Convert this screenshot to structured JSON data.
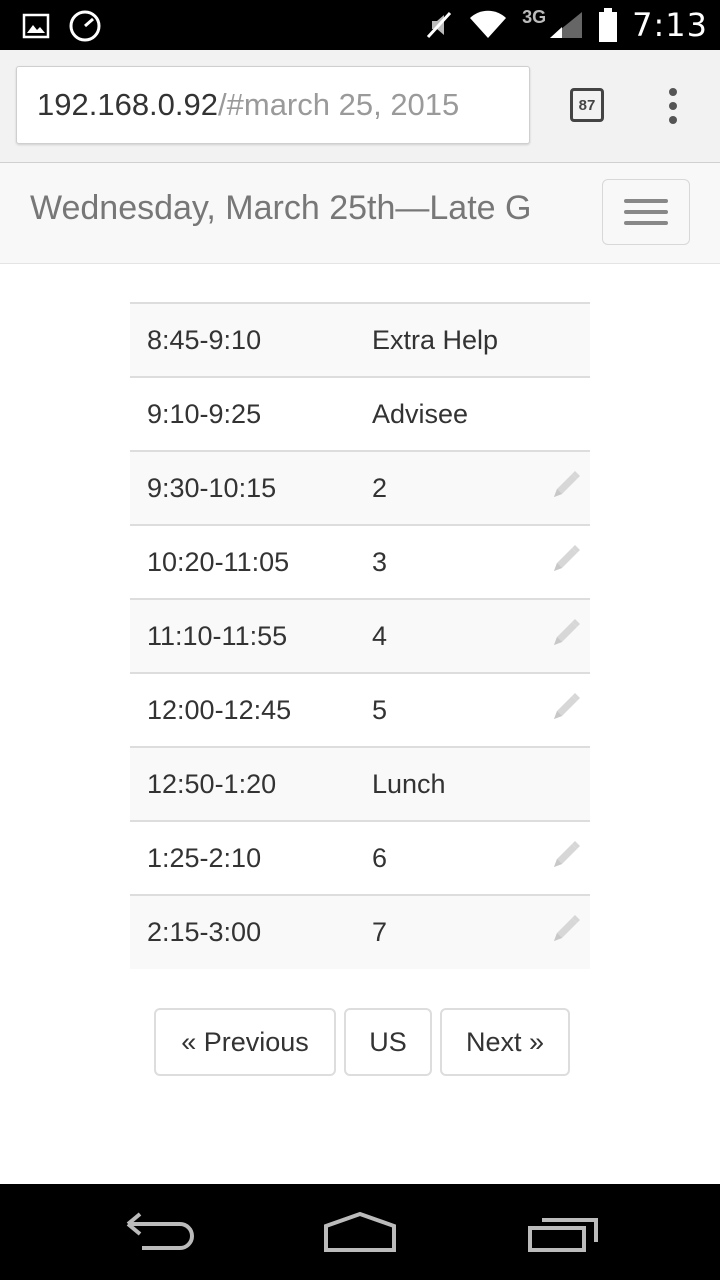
{
  "status_bar": {
    "time": "7:13",
    "network": "3G",
    "icons": [
      "image-icon",
      "speedometer-icon",
      "mute-icon",
      "wifi-icon",
      "signal-icon",
      "battery-icon"
    ]
  },
  "browser": {
    "url_host": "192.168.0.92",
    "url_path": "/#march 25, 2015",
    "tab_count": "87"
  },
  "navbar": {
    "title": "Wednesday, March 25th—Late G"
  },
  "schedule": {
    "rows": [
      {
        "time": "8:45-9:10",
        "period": "Extra Help",
        "editable": false
      },
      {
        "time": "9:10-9:25",
        "period": "Advisee",
        "editable": false
      },
      {
        "time": "9:30-10:15",
        "period": "2",
        "editable": true
      },
      {
        "time": "10:20-11:05",
        "period": "3",
        "editable": true
      },
      {
        "time": "11:10-11:55",
        "period": "4",
        "editable": true
      },
      {
        "time": "12:00-12:45",
        "period": "5",
        "editable": true
      },
      {
        "time": "12:50-1:20",
        "period": "Lunch",
        "editable": false
      },
      {
        "time": "1:25-2:10",
        "period": "6",
        "editable": true
      },
      {
        "time": "2:15-3:00",
        "period": "7",
        "editable": true
      }
    ]
  },
  "pager": {
    "previous": "« Previous",
    "middle": "US",
    "next": "Next »"
  }
}
